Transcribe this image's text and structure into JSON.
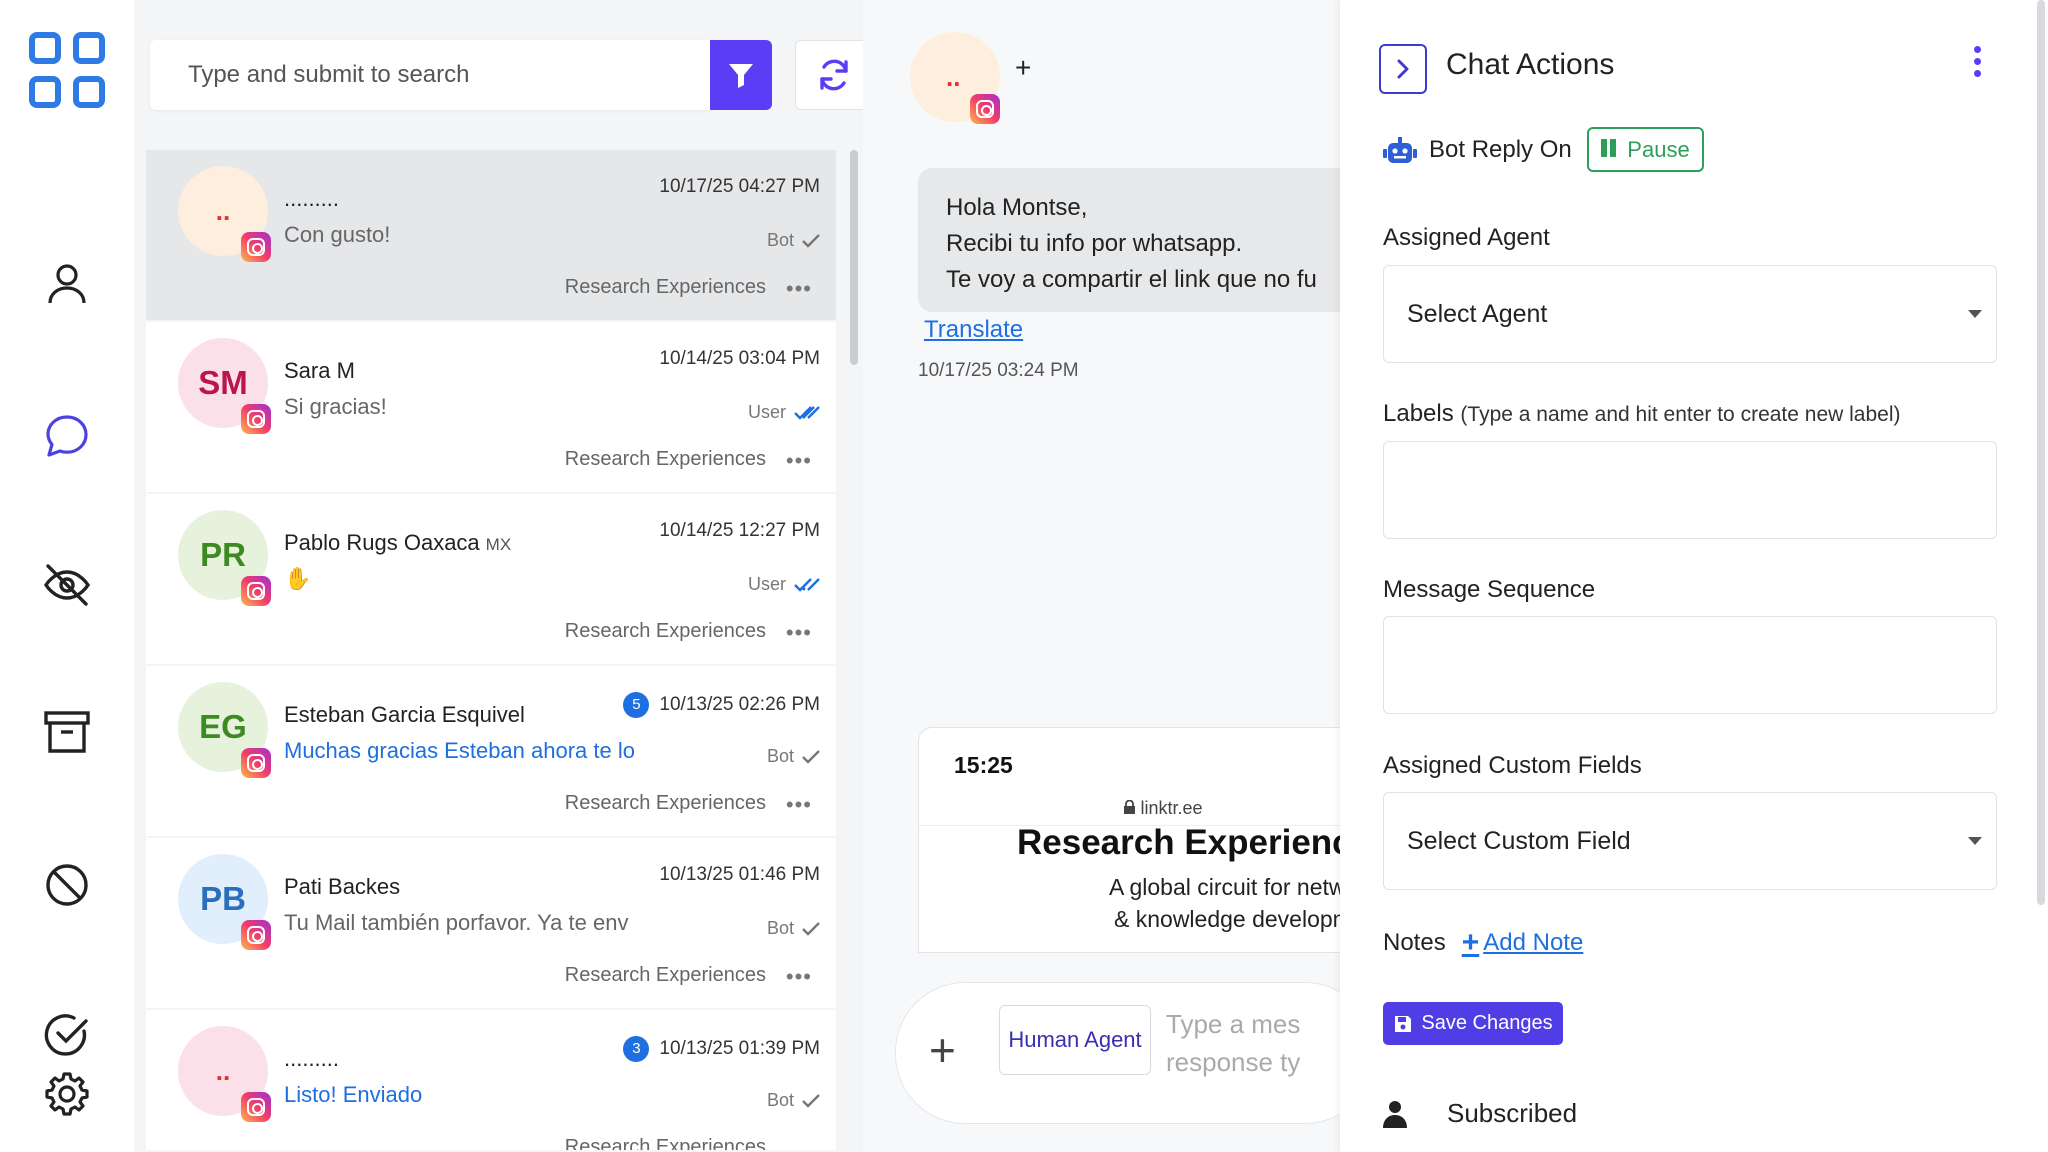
{
  "search": {
    "placeholder": "Type and submit to search"
  },
  "conversations": [
    {
      "initials": "..",
      "name": ".........",
      "time": "10/17/25 04:27 PM",
      "message": "Con gusto!",
      "status": "Bot",
      "label": "Research Experiences",
      "selected": true
    },
    {
      "initials": "SM",
      "name": "Sara M",
      "time": "10/14/25 03:04 PM",
      "message": "Si gracias!",
      "status": "User",
      "label": "Research Experiences"
    },
    {
      "initials": "PR",
      "name": "Pablo Rugs Oaxaca",
      "name_suffix": "MX",
      "time": "10/14/25 12:27 PM",
      "message": "✋",
      "status": "User",
      "label": "Research Experiences"
    },
    {
      "initials": "EG",
      "name": "Esteban Garcia Esquivel",
      "unread": "5",
      "time": "10/13/25 02:26 PM",
      "message": "Muchas gracias Esteban ahora te lo",
      "status": "Bot",
      "label": "Research Experiences"
    },
    {
      "initials": "PB",
      "name": "Pati Backes",
      "time": "10/13/25 01:46 PM",
      "message": "Tu Mail también porfavor. Ya te env",
      "status": "Bot",
      "label": "Research Experiences"
    },
    {
      "initials": "..",
      "name": ".........",
      "unread": "3",
      "time": "10/13/25 01:39 PM",
      "message": "Listo! Enviado",
      "status": "Bot",
      "label": "Research Experiences"
    }
  ],
  "chat": {
    "header_avatar": "..",
    "header_plus": "+",
    "message_lines": [
      "Hola Montse,",
      "Recibi tu info por whatsapp.",
      "Te voy a compartir el link que no fu"
    ],
    "translate": "Translate",
    "timestamp": "10/17/25 03:24 PM",
    "card": {
      "time": "15:25",
      "domain": "linktr.ee",
      "title": "Research Experienc",
      "subtitle_1": "A global circuit for network",
      "subtitle_2": "& knowledge developmen"
    },
    "composer": {
      "plus": "+",
      "human_agent": "Human Agent",
      "placeholder_1": "Type a mes",
      "placeholder_2": "response ty"
    }
  },
  "actions": {
    "title": "Chat Actions",
    "bot_reply": "Bot Reply On",
    "pause": "Pause",
    "assigned_agent_label": "Assigned Agent",
    "select_agent": "Select Agent",
    "labels_label": "Labels",
    "labels_hint": "(Type a name and hit enter to create new label)",
    "message_sequence_label": "Message Sequence",
    "custom_fields_label": "Assigned Custom Fields",
    "select_custom_field": "Select Custom Field",
    "notes_label": "Notes",
    "add_note": "Add Note",
    "save_changes": "Save Changes",
    "subscribed": "Subscribed"
  },
  "colors": {
    "accent": "#5b3df5",
    "link": "#1e6fe0",
    "success": "#2e9e5b",
    "rail_icon": "#222222",
    "active_icon": "#4a43e0"
  },
  "icons": [
    "apps-grid-icon",
    "user-icon",
    "chat-bubble-icon",
    "eye-off-icon",
    "archive-icon",
    "block-icon",
    "check-circle-icon",
    "gear-icon",
    "filter-icon",
    "refresh-icon",
    "instagram-icon",
    "robot-icon",
    "save-icon"
  ]
}
